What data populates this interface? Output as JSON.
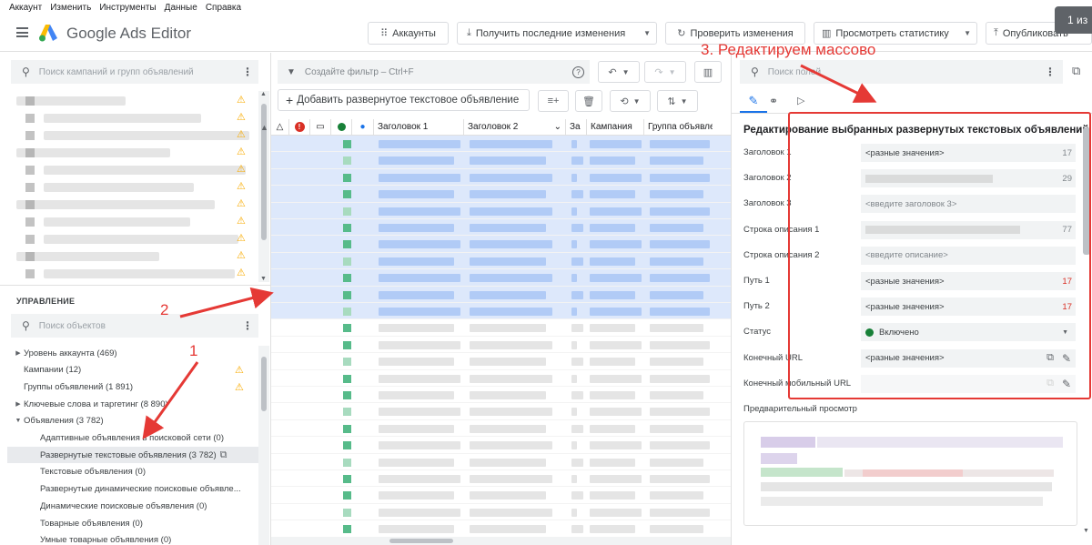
{
  "menu": [
    "Аккаунт",
    "Изменить",
    "Инструменты",
    "Данные",
    "Справка"
  ],
  "app": {
    "title": "Google Ads Editor"
  },
  "toolbar": {
    "accounts": "Аккаунты",
    "get_changes": "Получить последние изменения",
    "check_changes": "Проверить изменения",
    "view_stats": "Просмотреть статистику",
    "publish": "Опубликовать",
    "page_counter": "1 из"
  },
  "left": {
    "campaign_search_placeholder": "Поиск кампаний и групп объявлений",
    "manage_title": "УПРАВЛЕНИЕ",
    "object_search_placeholder": "Поиск объектов",
    "tree": [
      {
        "label": "Уровень аккаунта (469)",
        "expander": "right",
        "indent": 0
      },
      {
        "label": "Кампании (12)",
        "expander": "",
        "indent": 0,
        "warn": true
      },
      {
        "label": "Группы объявлений (1 891)",
        "expander": "",
        "indent": 0,
        "warn": true
      },
      {
        "label": "Ключевые слова и таргетинг (8 890)",
        "expander": "right",
        "indent": 0
      },
      {
        "label": "Объявления (3 782)",
        "expander": "down",
        "indent": 0
      },
      {
        "label": "Адаптивные объявления в поисковой сети (0)",
        "expander": "",
        "indent": 1
      },
      {
        "label": "Развернутые текстовые объявления (3 782)",
        "expander": "",
        "indent": 1,
        "selected": true
      },
      {
        "label": "Текстовые объявления (0)",
        "expander": "",
        "indent": 1
      },
      {
        "label": "Развернутые динамические поисковые объявле...",
        "expander": "",
        "indent": 1
      },
      {
        "label": "Динамические поисковые объявления (0)",
        "expander": "",
        "indent": 1
      },
      {
        "label": "Товарные объявления (0)",
        "expander": "",
        "indent": 1
      },
      {
        "label": "Умные товарные объявления (0)",
        "expander": "",
        "indent": 1
      }
    ]
  },
  "middle": {
    "filter_placeholder": "Создайте фильтр – Ctrl+F",
    "add_button": "Добавить развернутое текстовое объявление",
    "columns": [
      "Заголовок 1",
      "Заголовок 2",
      "За",
      "Кампания",
      "Группа объявлен"
    ]
  },
  "right": {
    "field_search_placeholder": "Поиск полей",
    "panel_title": "Редактирование выбранных развернутых текстовых объявлений",
    "fields": [
      {
        "label": "Заголовок 1",
        "value": "<разные значения>",
        "count": "17",
        "count_red": false,
        "placeholder": false
      },
      {
        "label": "Заголовок 2",
        "value": "",
        "count": "29",
        "count_red": false,
        "placeholder": false,
        "blurred": true
      },
      {
        "label": "Заголовок 3",
        "value": "<введите заголовок 3>",
        "count": "",
        "count_red": false,
        "placeholder": true
      },
      {
        "label": "Строка описания 1",
        "value": "",
        "count": "77",
        "count_red": false,
        "placeholder": false,
        "blurred": true
      },
      {
        "label": "Строка описания 2",
        "value": "<введите описание>",
        "count": "",
        "count_red": false,
        "placeholder": true
      },
      {
        "label": "Путь 1",
        "value": "<разные значения>",
        "count": "17",
        "count_red": true,
        "placeholder": false
      },
      {
        "label": "Путь 2",
        "value": "<разные значения>",
        "count": "17",
        "count_red": true,
        "placeholder": false
      },
      {
        "label": "Статус",
        "value": "Включено",
        "count": "",
        "count_red": false,
        "placeholder": false,
        "status": true
      },
      {
        "label": "Конечный URL",
        "value": "<разные значения>",
        "count": "",
        "count_red": false,
        "placeholder": false,
        "url": true
      },
      {
        "label": "Конечный мобильный URL",
        "value": "",
        "count": "",
        "count_red": false,
        "placeholder": false,
        "url": true,
        "disabled": true
      }
    ],
    "preview_label": "Предварительный просмотр"
  },
  "annotations": {
    "n1": "1",
    "n2": "2",
    "n3": "3. Редактируем массово"
  },
  "colors": {
    "accent_red": "#e53935",
    "status_green": "#188038",
    "selection": "#d2e3fc",
    "row_green": "#57bb8a"
  }
}
